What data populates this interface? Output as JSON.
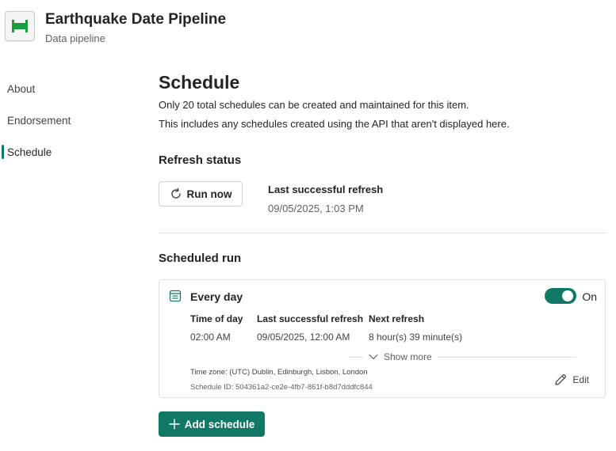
{
  "app": {
    "title": "Earthquake Date Pipeline",
    "subtitle": "Data pipeline",
    "icon": "pipeline-icon"
  },
  "sidebar": {
    "items": [
      {
        "label": "About",
        "active": false
      },
      {
        "label": "Endorsement",
        "active": false
      },
      {
        "label": "Schedule",
        "active": true
      }
    ]
  },
  "schedule": {
    "heading": "Schedule",
    "desc1": "Only 20 total schedules can be created and maintained for this item.",
    "desc2": "This includes any schedules created using the API that aren't displayed here.",
    "refresh_status": {
      "heading": "Refresh status",
      "run_now_label": "Run now",
      "last_refresh_label": "Last successful refresh",
      "last_refresh_value": "09/05/2025, 1:03 PM"
    },
    "scheduled_run": {
      "heading": "Scheduled run",
      "card": {
        "title": "Every day",
        "toggle_state": "On",
        "columns": [
          {
            "label": "Time of day",
            "value": "02:00 AM"
          },
          {
            "label": "Last successful refresh",
            "value": "09/05/2025, 12:00 AM"
          },
          {
            "label": "Next refresh",
            "value": "8 hour(s) 39 minute(s)"
          }
        ],
        "show_more_label": "Show more",
        "timezone": "Time zone: (UTC) Dublin, Edinburgh, Lisbon, London",
        "schedule_id": "Schedule ID: 504361a2-ce2e-4fb7-861f-b8d7dddfc844",
        "edit_label": "Edit"
      }
    },
    "add_schedule_label": "Add schedule"
  },
  "colors": {
    "accent": "#117865",
    "pipeline_icon": "#1b9e3f"
  }
}
